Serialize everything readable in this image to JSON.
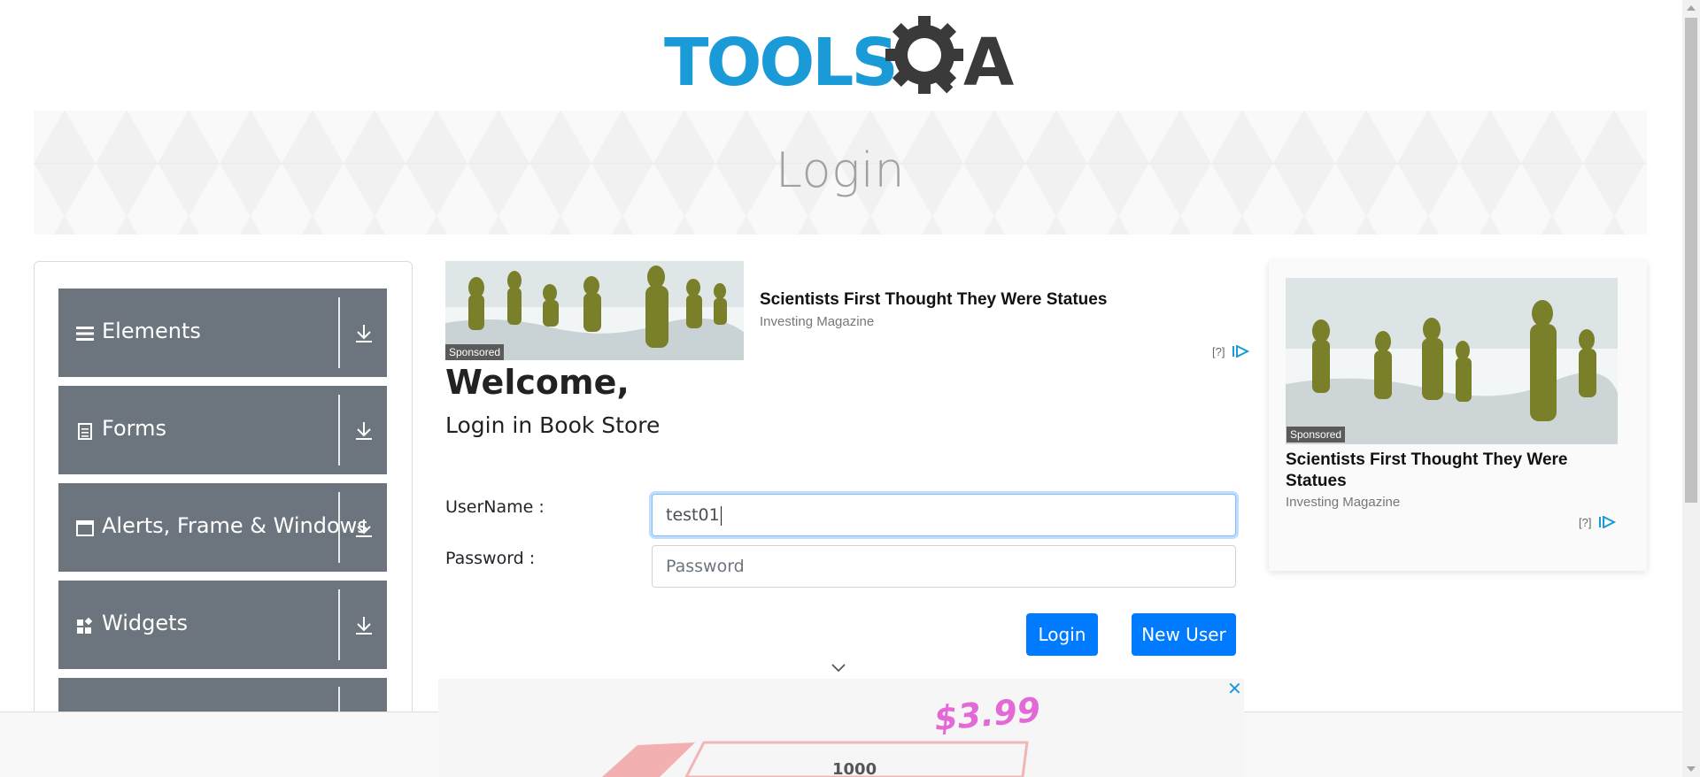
{
  "logo": {
    "text_left": "TOOLS",
    "text_right": "A",
    "accent_color": "#1a9bd7",
    "dark_color": "#3a3a3a"
  },
  "banner": {
    "title": "Login"
  },
  "sidebar": {
    "groups": [
      {
        "label": "Elements",
        "icon": "hamburger-icon"
      },
      {
        "label": "Forms",
        "icon": "document-icon"
      },
      {
        "label": "Alerts, Frame & Windows",
        "icon": "window-icon"
      },
      {
        "label": "Widgets",
        "icon": "widgets-icon"
      },
      {
        "label": "",
        "icon": ""
      }
    ],
    "group_color": "#6c757d"
  },
  "ad_top": {
    "title": "Scientists First Thought They Were Statues",
    "source": "Investing Magazine",
    "sponsored": "Sponsored",
    "mark": "[?]"
  },
  "main": {
    "heading": "Welcome,",
    "subheading": "Login in Book Store",
    "username_label": "UserName :",
    "username_value": "test01",
    "password_label": "Password :",
    "password_placeholder": "Password",
    "login_button": "Login",
    "new_user_button": "New User",
    "button_color": "#007bff"
  },
  "ad_right": {
    "title": "Scientists First Thought They Were Statues",
    "source": "Investing Magazine",
    "sponsored": "Sponsored",
    "mark": "[?]"
  },
  "bottom_ad": {
    "price": "$3.99",
    "count": "1000",
    "close": "✕"
  }
}
